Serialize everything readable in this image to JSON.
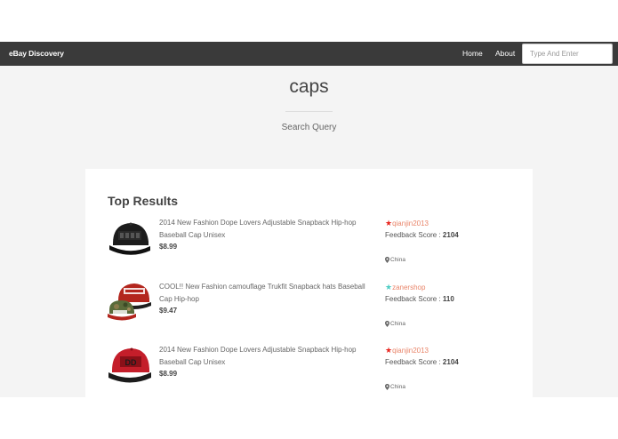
{
  "navbar": {
    "brand": "eBay Discovery",
    "links": [
      "Home",
      "About"
    ],
    "search_placeholder": "Type And Enter"
  },
  "query": {
    "text": "caps",
    "label": "Search Query"
  },
  "results": {
    "heading": "Top Results",
    "items": [
      {
        "title": "2014 New Fashion Dope Lovers Adjustable Snapback Hip-hop Baseball Cap Unisex",
        "price": "$8.99",
        "seller": "qianjin2013",
        "star_color": "#e8261f",
        "feedback_label": "Feedback Score : ",
        "feedback_score": "2104",
        "location": "China",
        "image": "black-snapback-cap"
      },
      {
        "title": "COOL!! New Fashion camouflage Trukfit Snapback hats Baseball Cap Hip-hop",
        "price": "$9.47",
        "seller": "zanershop",
        "star_color": "#4ecdc4",
        "feedback_label": "Feedback Score : ",
        "feedback_score": "110",
        "location": "China",
        "image": "camouflage-trukfit-cap"
      },
      {
        "title": "2014 New Fashion Dope Lovers Adjustable Snapback Hip-hop Baseball Cap Unisex",
        "price": "$8.99",
        "seller": "qianjin2013",
        "star_color": "#e8261f",
        "feedback_label": "Feedback Score : ",
        "feedback_score": "2104",
        "location": "China",
        "image": "red-snapback-cap"
      }
    ]
  },
  "colors": {
    "navbar": "#3a3a3a",
    "page_bg": "#f4f4f4",
    "seller_link": "#e9856a"
  }
}
